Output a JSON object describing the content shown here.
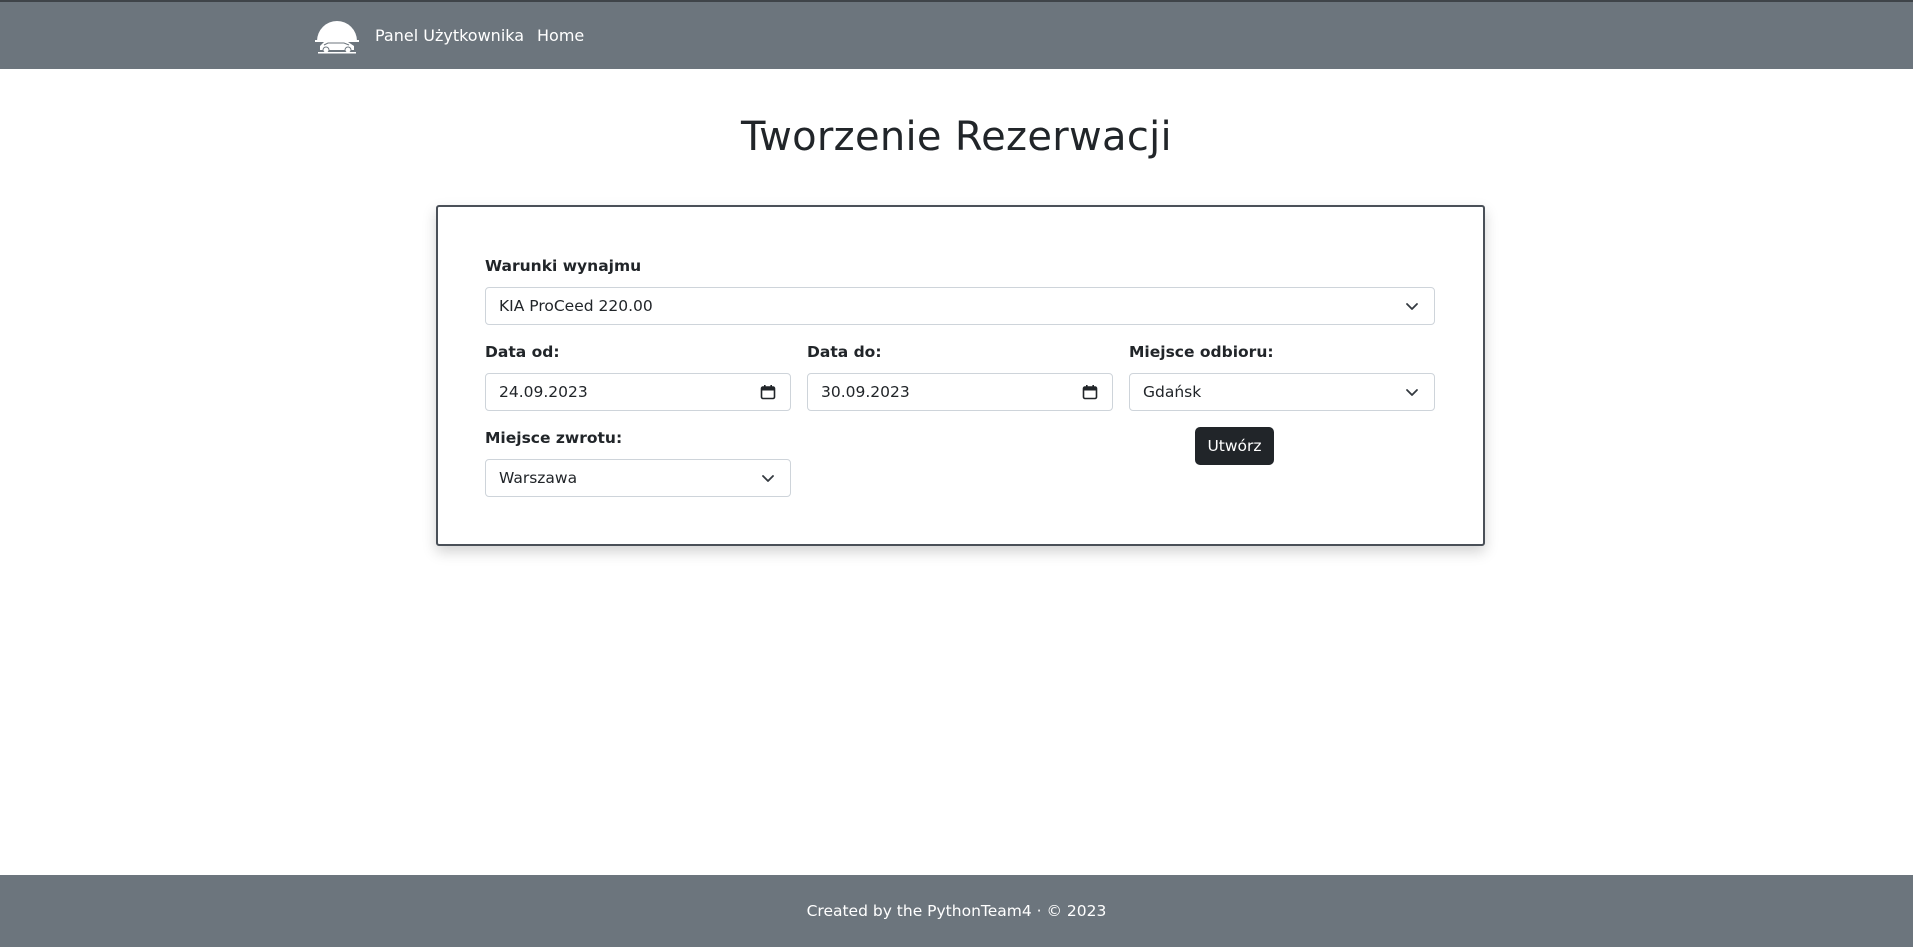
{
  "navbar": {
    "logo_icon": "car-sunset-logo-icon",
    "items": [
      {
        "label": "Panel Użytkownika"
      },
      {
        "label": "Home"
      }
    ],
    "background": "#6c757d"
  },
  "page": {
    "title": "Tworzenie Rezerwacji"
  },
  "form": {
    "terms": {
      "label": "Warunki wynajmu",
      "value": "KIA ProCeed 220.00"
    },
    "date_from": {
      "label": "Data od:",
      "value": "24.09.2023"
    },
    "date_to": {
      "label": "Data do:",
      "value": "30.09.2023"
    },
    "pickup": {
      "label": "Miejsce odbioru:",
      "value": "Gdańsk"
    },
    "return": {
      "label": "Miejsce zwrotu:",
      "value": "Warszawa"
    },
    "submit_label": "Utwórz"
  },
  "footer": {
    "text": "Created by the PythonTeam4 · © 2023"
  },
  "colors": {
    "navbar": "#6c757d",
    "button": "#212529",
    "card_border": "#4a5058"
  }
}
